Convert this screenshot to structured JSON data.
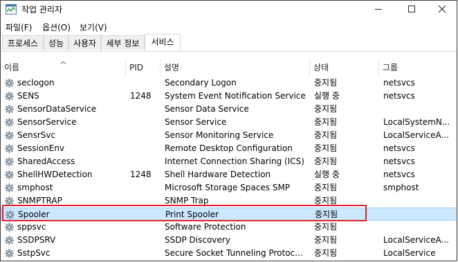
{
  "window": {
    "title": "작업 관리자"
  },
  "menu": [
    {
      "label": "파일(F)"
    },
    {
      "label": "옵션(O)"
    },
    {
      "label": "보기(V)"
    }
  ],
  "tabs": [
    {
      "label": "프로세스"
    },
    {
      "label": "성능"
    },
    {
      "label": "사용자"
    },
    {
      "label": "세부 정보"
    },
    {
      "label": "서비스",
      "active": true
    }
  ],
  "columns": {
    "name": "이름",
    "pid": "PID",
    "desc": "설명",
    "status": "상태",
    "group": "그룹"
  },
  "rows": [
    {
      "name": "seclogon",
      "pid": "",
      "desc": "Secondary Logon",
      "status": "중지됨",
      "group": "netsvcs"
    },
    {
      "name": "SENS",
      "pid": "1248",
      "desc": "System Event Notification Service",
      "status": "실행 중",
      "group": "netsvcs"
    },
    {
      "name": "SensorDataService",
      "pid": "",
      "desc": "Sensor Data Service",
      "status": "중지됨",
      "group": ""
    },
    {
      "name": "SensorService",
      "pid": "",
      "desc": "Sensor Service",
      "status": "중지됨",
      "group": "LocalSystemN..."
    },
    {
      "name": "SensrSvc",
      "pid": "",
      "desc": "Sensor Monitoring Service",
      "status": "중지됨",
      "group": "LocalServiceA..."
    },
    {
      "name": "SessionEnv",
      "pid": "",
      "desc": "Remote Desktop Configuration",
      "status": "중지됨",
      "group": "netsvcs"
    },
    {
      "name": "SharedAccess",
      "pid": "",
      "desc": "Internet Connection Sharing (ICS)",
      "status": "중지됨",
      "group": "netsvcs"
    },
    {
      "name": "ShellHWDetection",
      "pid": "1248",
      "desc": "Shell Hardware Detection",
      "status": "실행 중",
      "group": "netsvcs"
    },
    {
      "name": "smphost",
      "pid": "",
      "desc": "Microsoft Storage Spaces SMP",
      "status": "중지됨",
      "group": "smphost"
    },
    {
      "name": "SNMPTRAP",
      "pid": "",
      "desc": "SNMP Trap",
      "status": "중지됨",
      "group": ""
    },
    {
      "name": "Spooler",
      "pid": "",
      "desc": "Print Spooler",
      "status": "중지됨",
      "group": "",
      "selected": true
    },
    {
      "name": "sppsvc",
      "pid": "",
      "desc": "Software Protection",
      "status": "중지됨",
      "group": ""
    },
    {
      "name": "SSDPSRV",
      "pid": "",
      "desc": "SSDP Discovery",
      "status": "중지됨",
      "group": "LocalServiceA..."
    },
    {
      "name": "SstpSvc",
      "pid": "",
      "desc": "Secure Socket Tunneling Protocol S...",
      "status": "중지됨",
      "group": "LocalService"
    }
  ],
  "colors": {
    "selection": "#cce8ff",
    "selection_border": "#99d1ff",
    "highlight_box": "#e0202b"
  },
  "icons": {
    "app": "task-manager-icon",
    "service": "gear-icon",
    "sort": "sort-up-arrow-icon"
  }
}
